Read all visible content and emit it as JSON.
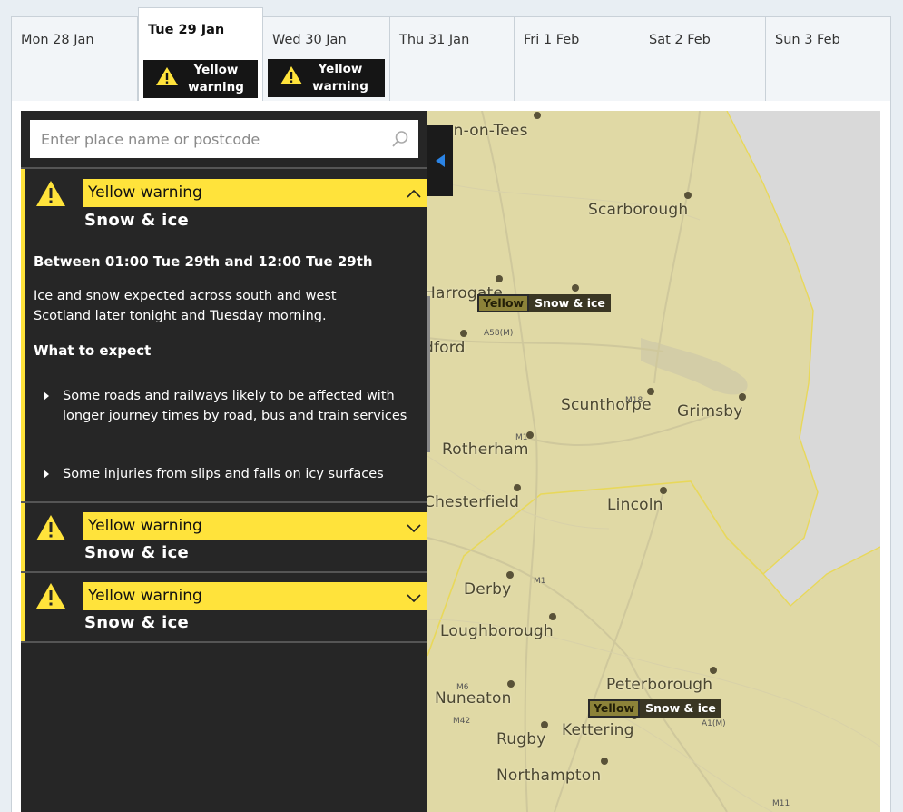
{
  "days": [
    {
      "label": "Mon 28 Jan"
    },
    {
      "label": "Tue 29 Jan",
      "badge": "Yellow warning"
    },
    {
      "label": "Wed 30 Jan",
      "badge": "Yellow warning"
    },
    {
      "label": "Thu 31 Jan"
    },
    {
      "label": "Fri 1 Feb"
    },
    {
      "label": "Sat 2 Feb"
    },
    {
      "label": "Sun 3 Feb"
    }
  ],
  "search": {
    "placeholder": "Enter place name or postcode",
    "value": ""
  },
  "warnings": [
    {
      "level": "Yellow warning",
      "type": "Snow & ice",
      "expanded": true,
      "period": "Between 01:00 Tue 29th and 12:00 Tue 29th",
      "description": "Ice and snow expected across south and west Scotland later tonight and Tuesday morning.",
      "what_heading": "What to expect",
      "bullets": [
        "Some roads and railways likely to be affected with longer journey times by road, bus and train services",
        "Some injuries from slips and falls on icy surfaces"
      ]
    },
    {
      "level": "Yellow warning",
      "type": "Snow & ice",
      "expanded": false
    },
    {
      "level": "Yellow warning",
      "type": "Snow & ice",
      "expanded": false
    }
  ],
  "map": {
    "towns": [
      "on-on-Tees",
      "Scarborough",
      "Harrogate",
      "dford",
      "Scunthorpe",
      "Grimsby",
      "Rotherham",
      "Chesterfield",
      "Lincoln",
      "Derby",
      "Loughborough",
      "Nuneaton",
      "Peterborough",
      "Kettering",
      "Rugby",
      "Northampton"
    ],
    "roads": [
      "A58(M)",
      "M18",
      "M1",
      "M1",
      "M6",
      "M42",
      "A1(M)",
      "M11"
    ],
    "labels": [
      {
        "level": "Yellow",
        "type": "Snow & ice"
      },
      {
        "level": "Yellow",
        "type": "Snow & ice"
      }
    ]
  },
  "colors": {
    "warning_yellow": "#ffe33b",
    "sidebar": "#262626",
    "land": "#e9e4c6",
    "warning_area": "#ded7a0",
    "sea": "#d9d9d9"
  }
}
